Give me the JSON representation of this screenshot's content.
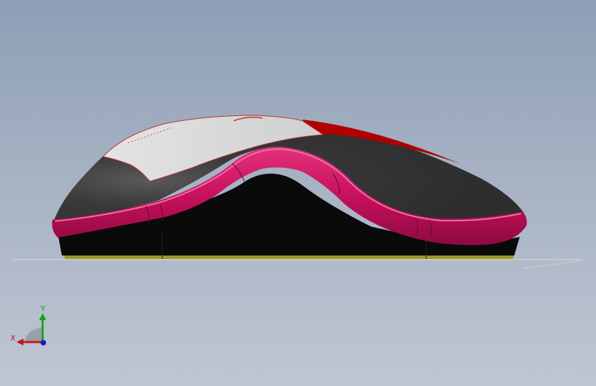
{
  "viewport": {
    "background_top": "#8e9eb5",
    "background_bottom": "#bfc6d2"
  },
  "model": {
    "colors": {
      "shell_dark": "#363636",
      "shell_light": "#dddddd",
      "accent_red": "#b20000",
      "trim_magenta": "#c8105c",
      "base_black": "#0a0a0a",
      "sole_yellow": "#9a9a20"
    }
  },
  "triad": {
    "x_label": "X",
    "y_label": "Y",
    "x_color": "#c01818",
    "y_color": "#18a018",
    "z_color": "#1818c8"
  }
}
